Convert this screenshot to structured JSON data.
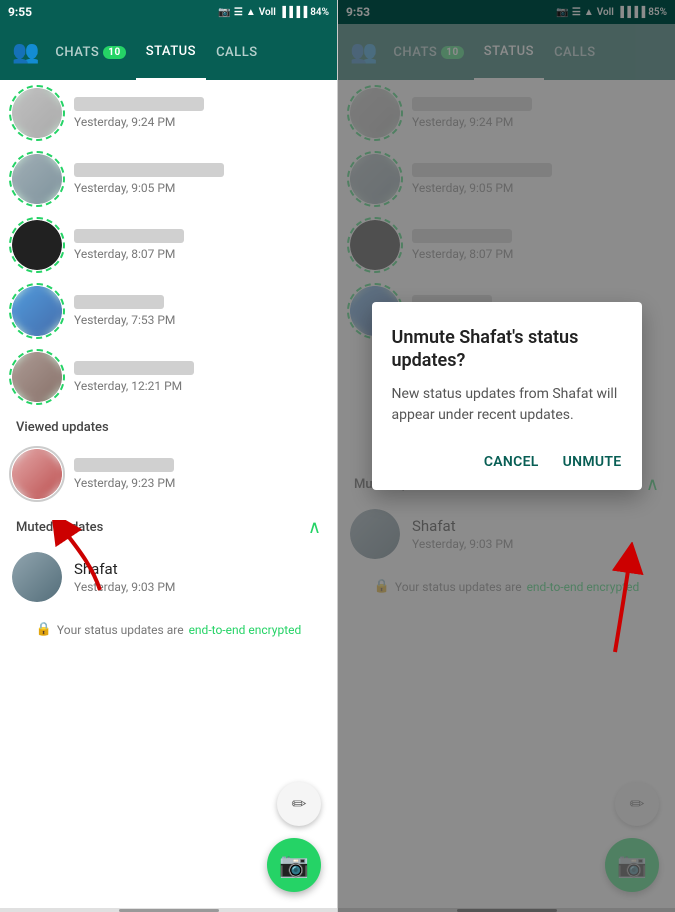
{
  "left_panel": {
    "status_bar": {
      "time": "9:55",
      "icons": "📷 📍 🔔 ⬆ ✦ Voll 84%"
    },
    "nav": {
      "people_icon": "👥",
      "tabs": [
        {
          "id": "chats",
          "label": "Chats",
          "badge": "10",
          "active": false
        },
        {
          "id": "status",
          "label": "Status",
          "badge": "",
          "active": true
        },
        {
          "id": "calls",
          "label": "Calls",
          "badge": "",
          "active": false
        }
      ]
    },
    "status_items": [
      {
        "id": "p1",
        "time": "Yesterday, 9:24 PM",
        "blurred": true,
        "ring": "dashed"
      },
      {
        "id": "p2",
        "time": "Yesterday, 9:05 PM",
        "blurred": true,
        "ring": "dashed"
      },
      {
        "id": "p3",
        "time": "Yesterday, 8:07 PM",
        "blurred": true,
        "ring": "dashed"
      },
      {
        "id": "p4",
        "time": "Yesterday, 7:53 PM",
        "blurred": true,
        "ring": "dashed"
      },
      {
        "id": "p5",
        "time": "Yesterday, 12:21 PM",
        "blurred": true,
        "ring": "dashed"
      }
    ],
    "viewed_section": {
      "label": "Viewed updates",
      "items": [
        {
          "id": "v1",
          "time": "Yesterday, 9:23 PM",
          "blurred": true,
          "ring": "viewed"
        }
      ]
    },
    "muted_section": {
      "label": "Muted updates",
      "items": [
        {
          "id": "shafat",
          "name": "Shafat",
          "time": "Yesterday, 9:03 PM",
          "ring": "none"
        }
      ]
    },
    "encryption_notice": {
      "text": "Your status updates are",
      "link": "end-to-end encrypted"
    },
    "fab_pencil": "✏",
    "fab_camera": "📷"
  },
  "right_panel": {
    "status_bar": {
      "time": "9:53",
      "icons": "📷 📍 🔔 ⬆ ✦ Voll 85%"
    },
    "nav": {
      "tabs": [
        {
          "id": "chats",
          "label": "Chats",
          "badge": "10",
          "active": false
        },
        {
          "id": "status",
          "label": "Status",
          "badge": "",
          "active": true
        },
        {
          "id": "calls",
          "label": "Calls",
          "badge": "",
          "active": false
        }
      ]
    },
    "dialog": {
      "title": "Unmute Shafat's status updates?",
      "body": "New status updates from Shafat will appear under recent updates.",
      "cancel_label": "Cancel",
      "unmute_label": "Unmute"
    },
    "muted_section": {
      "label": "Muted updates",
      "items": [
        {
          "id": "shafat2",
          "name": "Shafat",
          "time": "Yesterday, 9:03 PM"
        }
      ]
    },
    "encryption_notice": {
      "text": "Your status updates are",
      "link": "end-to-end encrypted"
    },
    "fab_pencil": "✏",
    "fab_camera": "📷"
  }
}
